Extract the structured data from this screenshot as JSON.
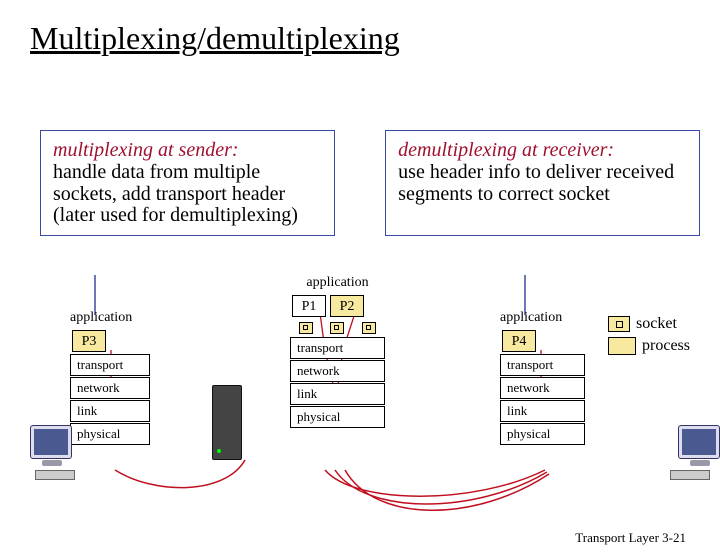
{
  "title": "Multiplexing/demultiplexing",
  "box_mux": {
    "title": "multiplexing at sender:",
    "text": "handle data from multiple sockets, add transport header (later used for demultiplexing)"
  },
  "box_demux": {
    "title": "demultiplexing at receiver:",
    "text": "use header info to deliver received segments to correct socket"
  },
  "layers": {
    "application": "application",
    "transport": "transport",
    "network": "network",
    "link": "link",
    "physical": "physical"
  },
  "procs": {
    "p1": "P1",
    "p2": "P2",
    "p3": "P3",
    "p4": "P4"
  },
  "legend": {
    "socket": "socket",
    "process": "process"
  },
  "footer": {
    "section": "Transport Layer",
    "page": "3-21"
  }
}
